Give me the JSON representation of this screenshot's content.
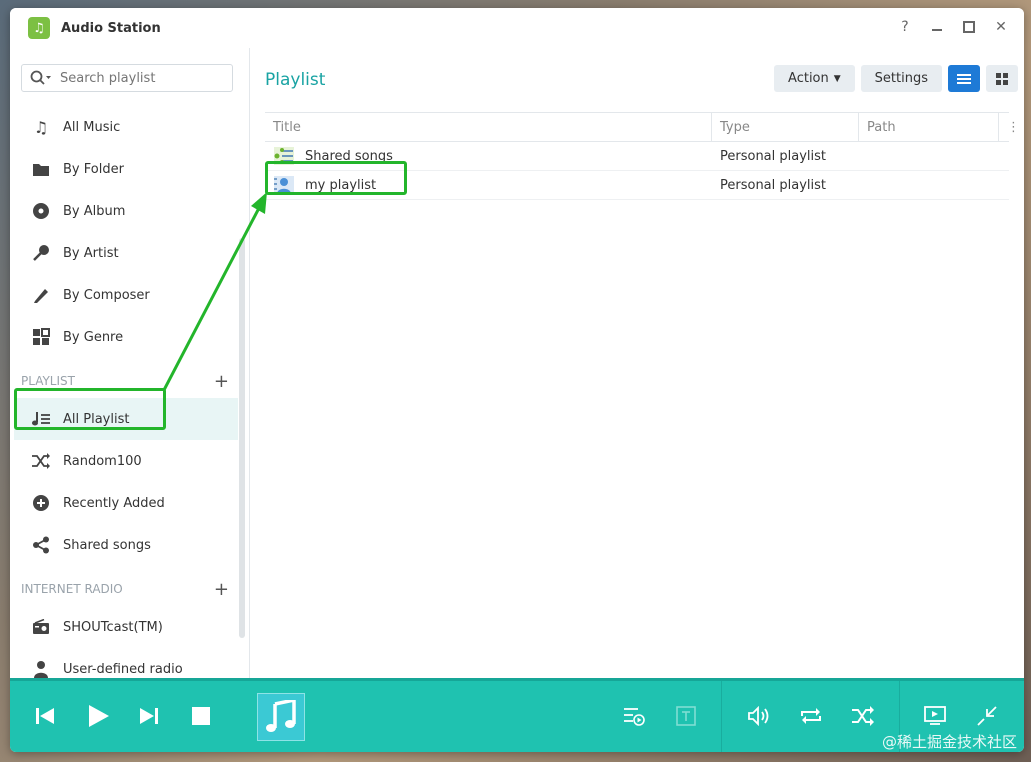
{
  "window": {
    "title": "Audio Station"
  },
  "sidebar": {
    "search_placeholder": "Search playlist",
    "library_items": [
      {
        "label": "All Music"
      },
      {
        "label": "By Folder"
      },
      {
        "label": "By Album"
      },
      {
        "label": "By Artist"
      },
      {
        "label": "By Composer"
      },
      {
        "label": "By Genre"
      }
    ],
    "playlist_header": "PLAYLIST",
    "playlist_items": [
      {
        "label": "All Playlist"
      },
      {
        "label": "Random100"
      },
      {
        "label": "Recently Added"
      },
      {
        "label": "Shared songs"
      }
    ],
    "radio_header": "INTERNET RADIO",
    "radio_items": [
      {
        "label": "SHOUTcast(TM)"
      },
      {
        "label": "User-defined radio"
      }
    ]
  },
  "main": {
    "title": "Playlist",
    "action_label": "Action",
    "settings_label": "Settings",
    "columns": [
      "Title",
      "Type",
      "Path"
    ],
    "rows": [
      {
        "title": "Shared songs",
        "type": "Personal playlist"
      },
      {
        "title": "my playlist",
        "type": "Personal playlist"
      }
    ]
  },
  "watermark": "@稀土掘金技术社区",
  "colors": {
    "accent": "#19a3a3",
    "player_bg": "#1fc2b0",
    "highlight": "#23b52b",
    "active_view": "#1e7ad6"
  }
}
